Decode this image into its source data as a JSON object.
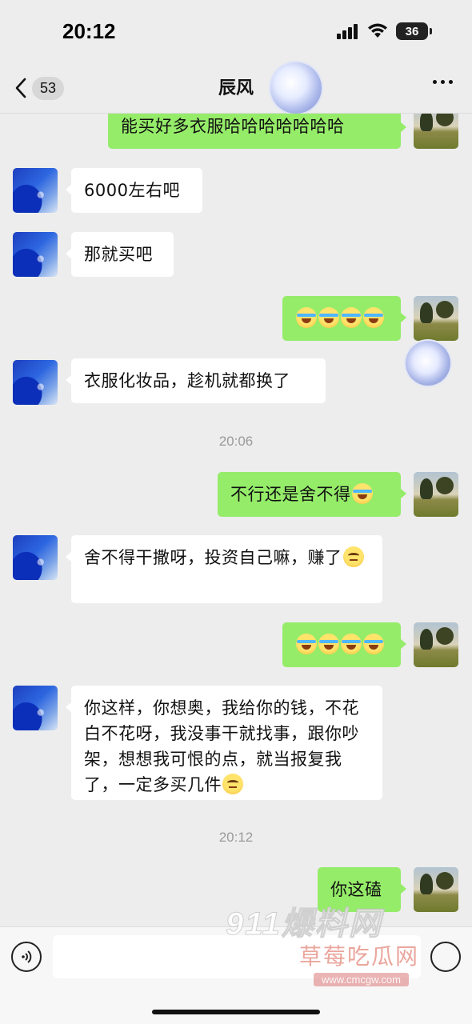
{
  "status_bar": {
    "time": "20:12",
    "battery": "36"
  },
  "nav": {
    "back_count": "53",
    "title": "辰风"
  },
  "messages": [
    {
      "side": "out",
      "text": "能买好多衣服哈哈哈哈哈哈哈"
    },
    {
      "side": "in",
      "text": "6000左右吧"
    },
    {
      "side": "in",
      "text": "那就买吧"
    },
    {
      "side": "out",
      "emojis": [
        "cry-laugh",
        "cry-laugh",
        "cry-laugh",
        "cry-laugh"
      ]
    },
    {
      "side": "in",
      "text": "衣服化妆品，趁机就都换了"
    },
    {
      "timestamp": "20:06"
    },
    {
      "side": "out",
      "text": "不行还是舍不得",
      "emojis": [
        "cry-laugh"
      ]
    },
    {
      "side": "in",
      "text": "舍不得干撒呀，投资自己嘛，赚了",
      "emojis": [
        "thinking"
      ]
    },
    {
      "side": "out",
      "emojis": [
        "cry-laugh",
        "cry-laugh",
        "cry-laugh",
        "cry-laugh"
      ]
    },
    {
      "side": "in",
      "text": "你这样，你想奥，我给你的钱，不花白不花呀，我没事干就找事，跟你吵架，想想我可恨的点，就当报复我了，一定多买几件",
      "emojis": [
        "thinking"
      ]
    },
    {
      "timestamp": "20:12"
    },
    {
      "side": "out",
      "text": "你这磕"
    }
  ],
  "watermark": {
    "top": "911爆料网",
    "middle": "草莓吃瓜网",
    "url": "www.cmcgw.com"
  },
  "colors": {
    "background": "#ededed",
    "bubble_out": "#95ec69",
    "bubble_in": "#ffffff"
  }
}
